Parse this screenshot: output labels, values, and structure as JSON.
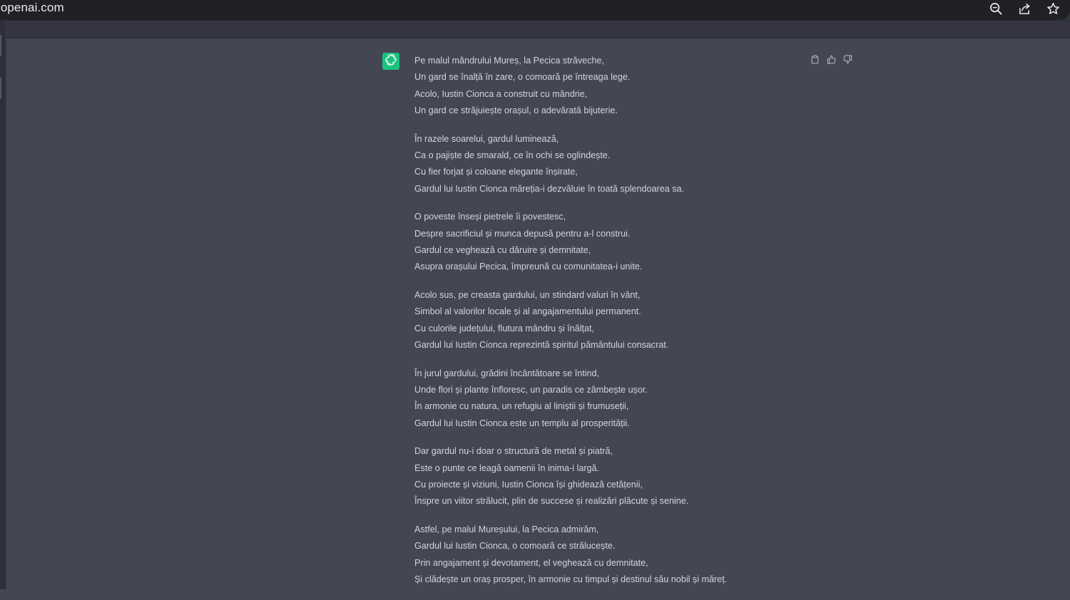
{
  "browser": {
    "url": ".openai.com",
    "icons": [
      "zoom-icon",
      "share-icon",
      "bookmark-star-icon"
    ]
  },
  "message": {
    "author": "assistant",
    "avatar_icon": "openai-logo-icon",
    "avatar_color": "#19c37d",
    "actions": [
      "copy-icon",
      "thumbs-up-icon",
      "thumbs-down-icon"
    ],
    "stanzas": [
      {
        "lines": [
          "Pe malul mândrului Mureș, la Pecica străveche,",
          "Un gard se înalță în zare, o comoară pe întreaga lege.",
          "Acolo, Iustin Cionca a construit cu mândrie,",
          "Un gard ce străjuiește orașul, o adevărată bijuterie."
        ]
      },
      {
        "lines": [
          "În razele soarelui, gardul luminează,",
          "Ca o pajiște de smarald, ce în ochi se oglindește.",
          "Cu fier forjat și coloane elegante înșirate,",
          "Gardul lui Iustin Cionca măreția-i dezvăluie în toată splendoarea sa."
        ]
      },
      {
        "lines": [
          "O poveste înseși pietrele îi povestesc,",
          "Despre sacrificiul și munca depusă pentru a-l construi.",
          "Gardul ce veghează cu dăruire și demnitate,",
          "Asupra orașului Pecica, împreună cu comunitatea-i unite."
        ]
      },
      {
        "lines": [
          "Acolo sus, pe creasta gardului, un stindard valuri în vânt,",
          "Simbol al valorilor locale și al angajamentului permanent.",
          "Cu culorile județului, flutura mândru și înălțat,",
          "Gardul lui Iustin Cionca reprezintă spiritul pământului consacrat."
        ]
      },
      {
        "lines": [
          "În jurul gardului, grădini încântătoare se întind,",
          "Unde flori și plante înfloresc, un paradis ce zâmbește ușor.",
          "În armonie cu natura, un refugiu al liniștii și frumuseții,",
          "Gardul lui Iustin Cionca este un templu al prosperității."
        ]
      },
      {
        "lines": [
          "Dar gardul nu-i doar o structură de metal și piatră,",
          "Este o punte ce leagă oamenii în inima-i largă.",
          "Cu proiecte și viziuni, Iustin Cionca își ghidează cetățenii,",
          "Înspre un viitor strălucit, plin de succese și realizări plăcute și senine."
        ]
      },
      {
        "lines": [
          "Astfel, pe malul Mureșului, la Pecica admirăm,",
          "Gardul lui Iustin Cionca, o comoară ce strălucește.",
          "Prin angajament și devotament, el veghează cu demnitate,",
          "Și clădește un oraș prosper, în armonie cu timpul și destinul său nobil și măreț."
        ]
      }
    ]
  }
}
